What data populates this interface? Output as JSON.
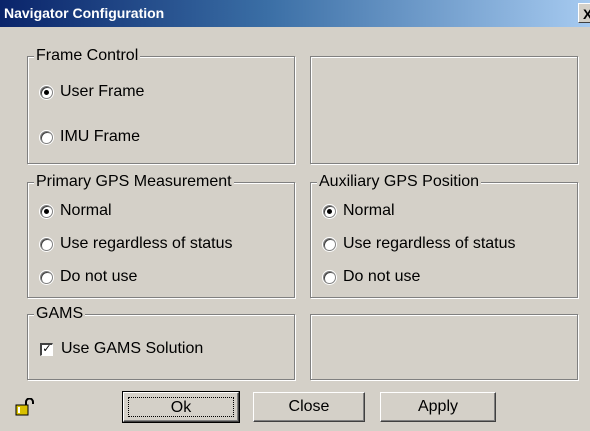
{
  "window": {
    "title": "Navigator Configuration",
    "close_glyph": "X"
  },
  "frame_control": {
    "legend": "Frame Control",
    "options": [
      {
        "label": "User Frame",
        "checked": true
      },
      {
        "label": "IMU Frame",
        "checked": false
      }
    ]
  },
  "primary_gps": {
    "legend": "Primary GPS Measurement",
    "options": [
      {
        "label": "Normal",
        "checked": true
      },
      {
        "label": "Use regardless of status",
        "checked": false
      },
      {
        "label": "Do not use",
        "checked": false
      }
    ]
  },
  "auxiliary_gps": {
    "legend": "Auxiliary GPS Position",
    "options": [
      {
        "label": "Normal",
        "checked": true
      },
      {
        "label": "Use regardless of status",
        "checked": false
      },
      {
        "label": "Do not use",
        "checked": false
      }
    ]
  },
  "gams": {
    "legend": "GAMS",
    "checkbox_label": "Use GAMS Solution",
    "checked": true
  },
  "buttons": {
    "ok": "Ok",
    "close": "Close",
    "apply": "Apply"
  },
  "icons": {
    "lock": "lock-open-icon"
  }
}
